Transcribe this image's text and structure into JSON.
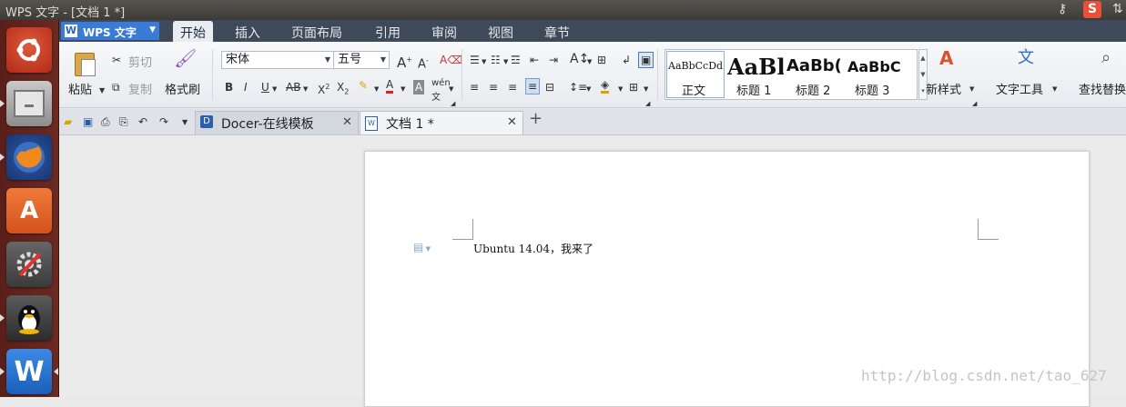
{
  "window": {
    "title": "WPS 文字 - [文档 1 *]"
  },
  "tray": {
    "ime_label": "S"
  },
  "launcher": {
    "apps": [
      "ubuntu-dash",
      "file-manager",
      "firefox",
      "software-center",
      "system-settings",
      "qq",
      "wps-writer"
    ]
  },
  "menubar": {
    "app_button": "WPS 文字",
    "tabs": [
      "开始",
      "插入",
      "页面布局",
      "引用",
      "审阅",
      "视图",
      "章节"
    ],
    "active_tab": "开始"
  },
  "ribbon": {
    "paste": "粘贴",
    "cut": "剪切",
    "copy": "复制",
    "format_painter": "格式刷",
    "font_name": "宋体",
    "font_size": "五号",
    "styles": [
      {
        "preview": "AaBbCcDd",
        "name": "正文"
      },
      {
        "preview": "AaBl",
        "name": "标题 1"
      },
      {
        "preview": "AaBb(",
        "name": "标题 2"
      },
      {
        "preview": "AaBbC",
        "name": "标题 3"
      }
    ],
    "new_style": "新样式",
    "text_tools": "文字工具",
    "find_replace": "查找替换"
  },
  "tabs": [
    {
      "label": "Docer-在线模板"
    },
    {
      "label": "文档 1 *"
    }
  ],
  "document": {
    "text": "Ubuntu 14.04，我来了"
  },
  "watermark": "http://blog.csdn.net/tao_627",
  "colors": {
    "accent": "#3a7bd5",
    "menubar": "#3e4a59",
    "launcher": "#6b2a22"
  }
}
